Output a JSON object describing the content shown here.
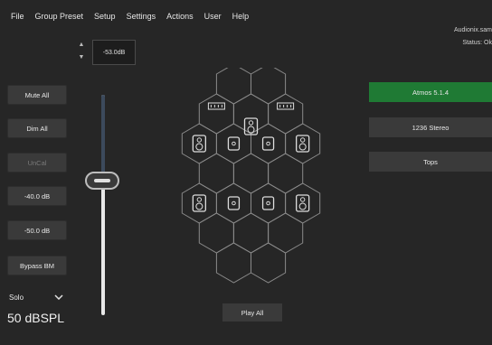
{
  "menu": [
    "File",
    "Group Preset",
    "Setup",
    "Settings",
    "Actions",
    "User",
    "Help"
  ],
  "status": {
    "user": "Audionix.sam",
    "status": "Status: Ok"
  },
  "level": {
    "stepper_up": "▲",
    "stepper_down": "▼",
    "value": "-53.0dB"
  },
  "left_buttons": [
    {
      "label": "Mute All",
      "enabled": true
    },
    {
      "label": "Dim All",
      "enabled": true
    },
    {
      "label": "UnCal",
      "enabled": false
    },
    {
      "label": "-40.0 dB",
      "enabled": true
    },
    {
      "label": "-50.0 dB",
      "enabled": true
    },
    {
      "label": "Bypass BM",
      "enabled": true
    }
  ],
  "solo_select": {
    "value": "Solo"
  },
  "spl": "50 dBSPL",
  "fader": {
    "level_fraction": 0.62
  },
  "presets": [
    {
      "label": "Atmos 5.1.4",
      "active": true
    },
    {
      "label": "1236 Stereo",
      "active": false
    },
    {
      "label": "Tops",
      "active": false
    }
  ],
  "play_all": "Play All",
  "colors": {
    "accent_green": "#1f7a34",
    "background": "#262626",
    "button": "#3a3a3a",
    "hex_line": "#8a8a8a"
  }
}
